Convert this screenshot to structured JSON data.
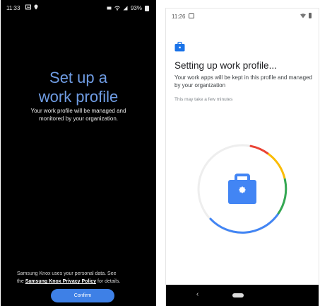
{
  "left_screen": {
    "status_bar": {
      "time": "11:33",
      "battery": "93%"
    },
    "title_line1": "Set up a",
    "title_line2": "work profile",
    "subtitle": "Your work profile will be managed and monitored by your organization.",
    "knox_note_prefix": "Samsung Knox uses your personal data. See the",
    "knox_link": "Samsung Knox Privacy Policy",
    "knox_note_suffix": "for details.",
    "confirm_button": "Confirm",
    "colors": {
      "title": "#6f9ce3",
      "button": "#3e80e6",
      "background": "#000000"
    }
  },
  "right_screen": {
    "status_bar": {
      "time": "11:26"
    },
    "title": "Setting up work profile...",
    "subtitle": "Your work apps will be kept in this profile and managed by your organization",
    "hint": "This may take a few minutes",
    "nav_back": "‹",
    "icons": {
      "header": "briefcase-icon",
      "center": "briefcase-icon"
    },
    "colors": {
      "accent": "#4285f4",
      "ring_green": "#34a853",
      "ring_yellow": "#fbbc04",
      "ring_red": "#ea4335"
    }
  }
}
